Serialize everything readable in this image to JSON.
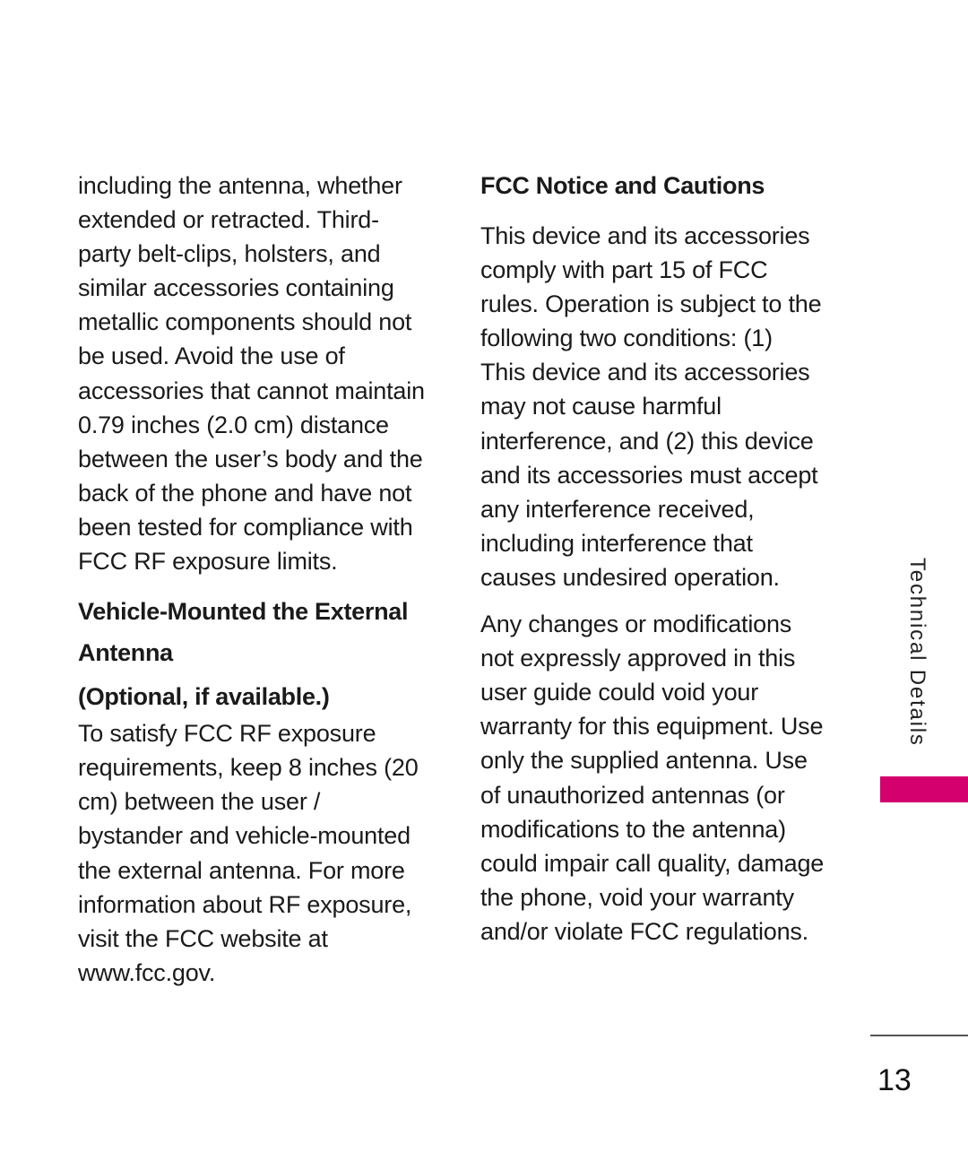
{
  "left_column": {
    "intro_lines": [
      "including the antenna, whether",
      "extended or retracted. Third-",
      "party belt-clips, holsters, and",
      "similar accessories containing",
      "metallic components should not",
      "be used. Avoid the use of",
      "accessories that cannot maintain",
      "0.79 inches (2.0 cm) distance",
      "between the user’s body and the",
      "back of the phone and have not",
      "been tested for compliance with",
      "FCC RF exposure limits."
    ],
    "heading_line1": "Vehicle-Mounted the External",
    "heading_line2": "Antenna",
    "heading_line3": "(Optional, if available.)",
    "body_lines": [
      "To satisfy FCC RF exposure",
      "requirements, keep 8 inches (20",
      "cm) between the user /",
      "bystander and vehicle-mounted",
      "the external antenna. For more",
      "information about RF exposure,",
      "visit the FCC website at",
      "www.fcc.gov."
    ]
  },
  "right_column": {
    "heading": "FCC Notice and Cautions",
    "para1_lines": [
      "This device and its accessories",
      "comply with part 15 of FCC",
      "rules. Operation is subject to the",
      "following two conditions: (1)",
      "This device and its accessories",
      "may not cause harmful",
      "interference, and (2) this device",
      "and its accessories must accept",
      "any interference received,",
      "including interference that",
      "causes undesired operation."
    ],
    "para2_lines": [
      "Any changes or modifications",
      "not expressly approved in this",
      "user guide could void your",
      "warranty for this equipment.  Use",
      "only the supplied antenna. Use",
      "of unauthorized antennas (or",
      "modifications to the antenna)",
      "could impair call quality, damage",
      "the phone, void your warranty",
      "and/or violate FCC regulations."
    ]
  },
  "sidebar": {
    "section_label": "Technical Details",
    "accent_color": "#d4006e"
  },
  "footer": {
    "page_number": "13"
  }
}
